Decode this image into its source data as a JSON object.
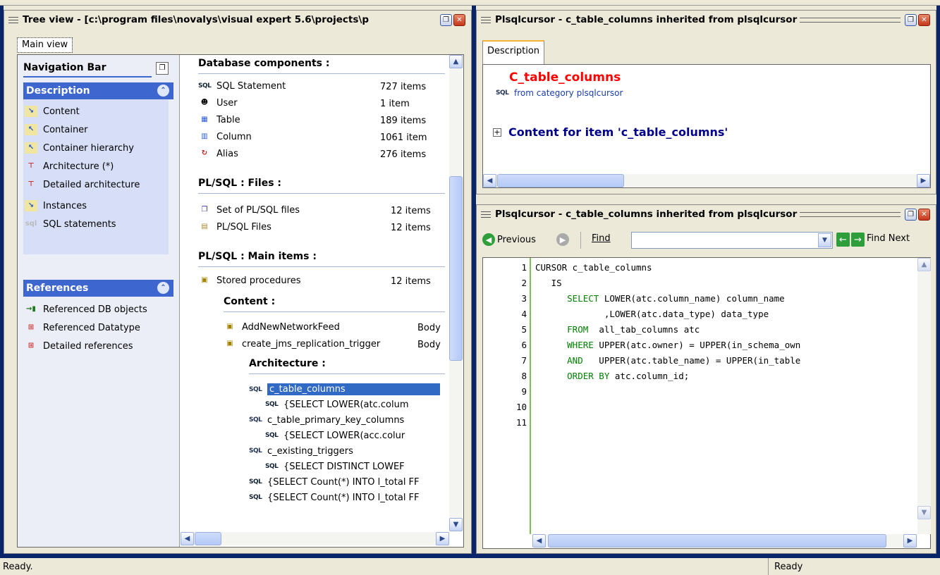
{
  "left_pane": {
    "title": "Tree view - [c:\\program files\\novalys\\visual expert 5.6\\projects\\p",
    "tab": "Main view",
    "nav": {
      "title": "Navigation Bar",
      "description_header": "Description",
      "description_items": [
        "Content",
        "Container",
        "Container hierarchy",
        "Architecture (*)",
        "Detailed architecture",
        "Instances",
        "SQL statements"
      ],
      "references_header": "References",
      "reference_items": [
        "Referenced DB objects",
        "Referenced Datatype",
        "Detailed references"
      ]
    },
    "db_section": "Database components :",
    "db_items": [
      {
        "icon": "sql-icon",
        "label": "SQL Statement",
        "count": "727 items"
      },
      {
        "icon": "user-icon",
        "label": "User",
        "count": "1 item"
      },
      {
        "icon": "table-icon",
        "label": "Table",
        "count": "189 items"
      },
      {
        "icon": "column-icon",
        "label": "Column",
        "count": "1061 item"
      },
      {
        "icon": "alias-icon",
        "label": "Alias",
        "count": "276 items"
      }
    ],
    "files_section": "PL/SQL : Files :",
    "file_items": [
      {
        "icon": "file-set-icon",
        "label": "Set of PL/SQL files",
        "count": "12 items"
      },
      {
        "icon": "file-icon",
        "label": "PL/SQL Files",
        "count": "12 items"
      }
    ],
    "main_section": "PL/SQL : Main items :",
    "main_items": [
      {
        "icon": "procedure-icon",
        "label": "Stored procedures",
        "count": "12 items"
      }
    ],
    "content_section": "Content :",
    "content_items": [
      {
        "label": "AddNewNetworkFeed",
        "type": "Body"
      },
      {
        "label": "create_jms_replication_trigger",
        "type": "Body"
      }
    ],
    "arch_section": "Architecture :",
    "arch_items": [
      {
        "label": "c_table_columns",
        "indent": 0
      },
      {
        "label": "{SELECT LOWER(atc.colum",
        "indent": 1
      },
      {
        "label": "c_table_primary_key_columns",
        "indent": 0
      },
      {
        "label": "{SELECT LOWER(acc.colur",
        "indent": 1
      },
      {
        "label": "c_existing_triggers",
        "indent": 0
      },
      {
        "label": "{SELECT DISTINCT LOWEF",
        "indent": 1
      },
      {
        "label": "{SELECT Count(*) INTO l_total FF",
        "indent": -1
      },
      {
        "label": "{SELECT Count(*) INTO l_total FF",
        "indent": -1
      }
    ]
  },
  "right_top": {
    "title": "Plsqlcursor - c_table_columns inherited from plsqlcursor",
    "tab": "Description",
    "item_name": "C_table_columns",
    "category": "from category plsqlcursor",
    "content_heading": "Content for item 'c_table_columns'"
  },
  "right_bottom": {
    "title": "Plsqlcursor - c_table_columns inherited from plsqlcursor",
    "previous_label": "Previous",
    "find_label": "Find",
    "find_value": "",
    "find_next_label": "Find Next",
    "line_numbers": [
      "1",
      "2",
      "3",
      "4",
      "5",
      "6",
      "7",
      "8",
      "9",
      "10",
      "11"
    ],
    "code_lines": [
      [
        {
          "t": "CURSOR c_table_columns",
          "k": false
        }
      ],
      [
        {
          "t": "   IS",
          "k": false
        }
      ],
      [
        {
          "t": "      ",
          "k": false
        },
        {
          "t": "SELECT",
          "k": true
        },
        {
          "t": " LOWER(atc.column_name) column_name",
          "k": false
        }
      ],
      [
        {
          "t": "             ,LOWER(atc.data_type) data_type",
          "k": false
        }
      ],
      [
        {
          "t": "      ",
          "k": false
        },
        {
          "t": "FROM",
          "k": true
        },
        {
          "t": "  all_tab_columns atc",
          "k": false
        }
      ],
      [
        {
          "t": "      ",
          "k": false
        },
        {
          "t": "WHERE",
          "k": true
        },
        {
          "t": " UPPER(atc.owner) = UPPER(in_schema_own",
          "k": false
        }
      ],
      [
        {
          "t": "      ",
          "k": false
        },
        {
          "t": "AND",
          "k": true
        },
        {
          "t": "   UPPER(atc.table_name) = UPPER(in_table",
          "k": false
        }
      ],
      [
        {
          "t": "      ",
          "k": false
        },
        {
          "t": "ORDER BY",
          "k": true
        },
        {
          "t": " atc.column_id;",
          "k": false
        }
      ],
      [],
      [],
      []
    ]
  },
  "status": {
    "left": "Ready.",
    "right": "Ready"
  },
  "colors": {
    "accent_blue": "#3d66cf",
    "frame": "#0a246a",
    "highlight": "#316ac5",
    "item_red": "#ff0000",
    "heading_blue": "#00008b",
    "keyword_green": "#008000"
  }
}
